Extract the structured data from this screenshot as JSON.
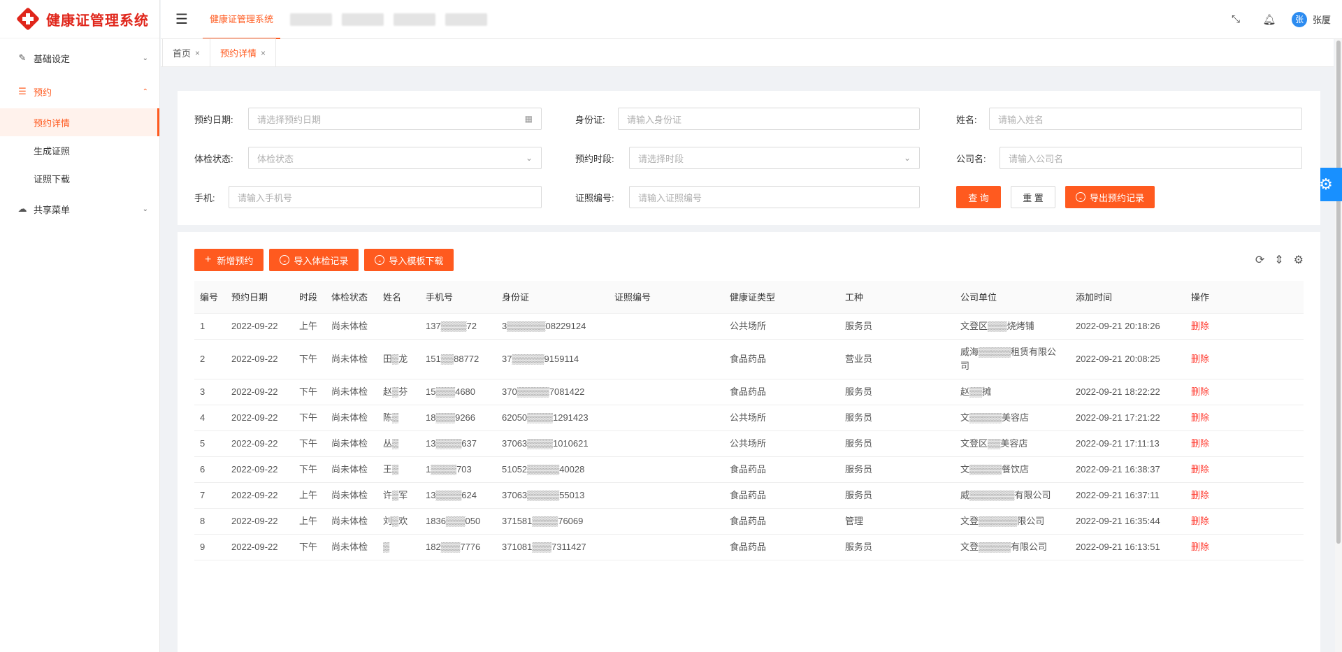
{
  "app": {
    "title": "健康证管理系统"
  },
  "header": {
    "active_tab": "健康证管理系统",
    "user_name": "张厦",
    "avatar_initial": "张"
  },
  "sidebar": {
    "items": [
      {
        "label": "基础设定",
        "icon": "edit-icon",
        "arrow": "v"
      },
      {
        "label": "预约",
        "icon": "list-icon",
        "arrow": "^"
      },
      {
        "label": "共享菜单",
        "icon": "cloud-icon",
        "arrow": "v"
      }
    ],
    "sub_items": [
      "预约详情",
      "生成证照",
      "证照下载"
    ]
  },
  "page_tabs": [
    {
      "label": "首页",
      "close": "×"
    },
    {
      "label": "预约详情",
      "close": "×"
    }
  ],
  "filters": {
    "date_label": "预约日期:",
    "date_placeholder": "请选择预约日期",
    "idcard_label": "身份证:",
    "idcard_placeholder": "请输入身份证",
    "name_label": "姓名:",
    "name_placeholder": "请输入姓名",
    "status_label": "体检状态:",
    "status_placeholder": "体检状态",
    "period_label": "预约时段:",
    "period_placeholder": "请选择时段",
    "company_label": "公司名:",
    "company_placeholder": "请输入公司名",
    "phone_label": "手机:",
    "phone_placeholder": "请输入手机号",
    "cert_label": "证照编号:",
    "cert_placeholder": "请输入证照编号",
    "search_btn": "查 询",
    "reset_btn": "重 置",
    "export_btn": "导出预约记录"
  },
  "toolbar": {
    "add_btn": "新增预约",
    "import_btn": "导入体检记录",
    "template_btn": "导入模板下载"
  },
  "table": {
    "columns": [
      "编号",
      "预约日期",
      "时段",
      "体检状态",
      "姓名",
      "手机号",
      "身份证",
      "证照编号",
      "健康证类型",
      "工种",
      "公司单位",
      "添加时间",
      "操作"
    ],
    "rows": [
      [
        "1",
        "2022-09-22",
        "上午",
        "尚未体检",
        "",
        "137▒▒▒▒72",
        "3▒▒▒▒▒▒08229124",
        "",
        "公共场所",
        "服务员",
        "文登区▒▒▒烧烤铺",
        "2022-09-21 20:18:26",
        "删除"
      ],
      [
        "2",
        "2022-09-22",
        "下午",
        "尚未体检",
        "田▒龙",
        "151▒▒88772",
        "37▒▒▒▒▒9159114",
        "",
        "食品药品",
        "营业员",
        "威海▒▒▒▒▒租赁有限公司",
        "2022-09-21 20:08:25",
        "删除"
      ],
      [
        "3",
        "2022-09-22",
        "下午",
        "尚未体检",
        "赵▒芬",
        "15▒▒▒4680",
        "370▒▒▒▒▒7081422",
        "",
        "食品药品",
        "服务员",
        "赵▒▒摊",
        "2022-09-21 18:22:22",
        "删除"
      ],
      [
        "4",
        "2022-09-22",
        "下午",
        "尚未体检",
        "陈▒",
        "18▒▒▒9266",
        "62050▒▒▒▒1291423",
        "",
        "公共场所",
        "服务员",
        "文▒▒▒▒▒美容店",
        "2022-09-21 17:21:22",
        "删除"
      ],
      [
        "5",
        "2022-09-22",
        "下午",
        "尚未体检",
        "丛▒",
        "13▒▒▒▒637",
        "37063▒▒▒▒1010621",
        "",
        "公共场所",
        "服务员",
        "文登区▒▒美容店",
        "2022-09-21 17:11:13",
        "删除"
      ],
      [
        "6",
        "2022-09-22",
        "下午",
        "尚未体检",
        "王▒",
        "1▒▒▒▒703",
        "51052▒▒▒▒▒40028",
        "",
        "食品药品",
        "服务员",
        "文▒▒▒▒▒餐饮店",
        "2022-09-21 16:38:37",
        "删除"
      ],
      [
        "7",
        "2022-09-22",
        "上午",
        "尚未体检",
        "许▒军",
        "13▒▒▒▒624",
        "37063▒▒▒▒▒55013",
        "",
        "食品药品",
        "服务员",
        "威▒▒▒▒▒▒▒有限公司",
        "2022-09-21 16:37:11",
        "删除"
      ],
      [
        "8",
        "2022-09-22",
        "上午",
        "尚未体检",
        "刘▒欢",
        "1836▒▒▒050",
        "371581▒▒▒▒76069",
        "",
        "食品药品",
        "管理",
        "文登▒▒▒▒▒▒限公司",
        "2022-09-21 16:35:44",
        "删除"
      ],
      [
        "9",
        "2022-09-22",
        "下午",
        "尚未体检",
        "▒",
        "182▒▒▒7776",
        "371081▒▒▒7311427",
        "",
        "食品药品",
        "服务员",
        "文登▒▒▒▒▒有限公司",
        "2022-09-21 16:13:51",
        "删除"
      ]
    ]
  },
  "colors": {
    "primary": "#ff5a1f",
    "brand_red": "#e0261b",
    "float_blue": "#1890ff",
    "danger": "#ff3b30"
  }
}
